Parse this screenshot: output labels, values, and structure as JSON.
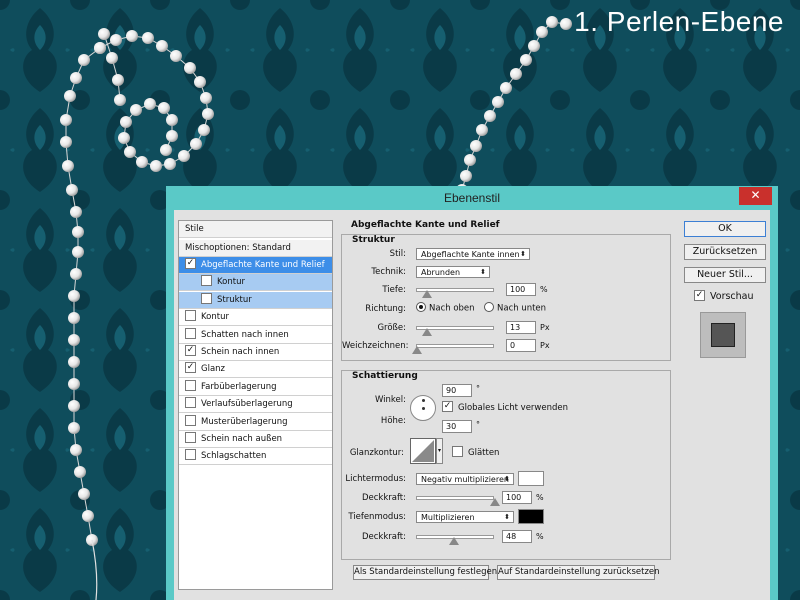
{
  "page": {
    "title": "1. Perlen-Ebene"
  },
  "colors": {
    "background": "#0e4a58",
    "dialog_frame": "#5ac9c7",
    "selection": "#3d8ee8",
    "sub_selection": "#a7cbf2",
    "close": "#c9302c"
  },
  "dialog": {
    "title": "Ebenenstil",
    "close_glyph": "✕",
    "styles_list": {
      "header": "Stile",
      "blending_options": "Mischoptionen: Standard",
      "items": [
        {
          "label": "Abgeflachte Kante und Relief",
          "checked": true,
          "selected": true
        },
        {
          "label": "Kontur",
          "checked": false,
          "sub": true
        },
        {
          "label": "Struktur",
          "checked": false,
          "sub": true
        },
        {
          "label": "Kontur",
          "checked": false
        },
        {
          "label": "Schatten nach innen",
          "checked": false
        },
        {
          "label": "Schein nach innen",
          "checked": true
        },
        {
          "label": "Glanz",
          "checked": true
        },
        {
          "label": "Farbüberlagerung",
          "checked": false
        },
        {
          "label": "Verlaufsüberlagerung",
          "checked": false
        },
        {
          "label": "Musterüberlagerung",
          "checked": false
        },
        {
          "label": "Schein nach außen",
          "checked": false
        },
        {
          "label": "Schlagschatten",
          "checked": false
        }
      ]
    },
    "bevel": {
      "section_title": "Abgeflachte Kante und Relief",
      "structure": {
        "title": "Struktur",
        "style_label": "Stil:",
        "style_value": "Abgeflachte Kante innen",
        "technique_label": "Technik:",
        "technique_value": "Abrunden",
        "depth_label": "Tiefe:",
        "depth_value": "100",
        "depth_unit": "%",
        "direction_label": "Richtung:",
        "direction_up": "Nach oben",
        "direction_down": "Nach unten",
        "size_label": "Größe:",
        "size_value": "13",
        "size_unit": "Px",
        "soften_label": "Weichzeichnen:",
        "soften_value": "0",
        "soften_unit": "Px"
      },
      "shading": {
        "title": "Schattierung",
        "angle_label": "Winkel:",
        "angle_value": "90",
        "angle_unit": "°",
        "global_light_label": "Globales Licht verwenden",
        "global_light_checked": true,
        "altitude_label": "Höhe:",
        "altitude_value": "30",
        "altitude_unit": "°",
        "gloss_contour_label": "Glanzkontur:",
        "antialias_label": "Glätten",
        "antialias_checked": false,
        "highlight_mode_label": "Lichtermodus:",
        "highlight_mode_value": "Negativ multiplizieren",
        "highlight_color": "#ffffff",
        "highlight_opacity_label": "Deckkraft:",
        "highlight_opacity_value": "100",
        "highlight_opacity_unit": "%",
        "shadow_mode_label": "Tiefenmodus:",
        "shadow_mode_value": "Multiplizieren",
        "shadow_color": "#000000",
        "shadow_opacity_label": "Deckkraft:",
        "shadow_opacity_value": "48",
        "shadow_opacity_unit": "%"
      },
      "set_default": "Als Standardeinstellung festlegen",
      "reset_default": "Auf Standardeinstellung zurücksetzen"
    },
    "buttons": {
      "ok": "OK",
      "reset": "Zurücksetzen",
      "new_style": "Neuer Stil...",
      "preview_label": "Vorschau",
      "preview_checked": true
    }
  }
}
